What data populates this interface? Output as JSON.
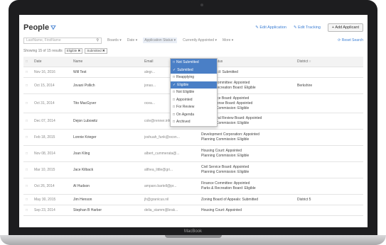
{
  "device": {
    "brand": "MacBook"
  },
  "header": {
    "title": "People",
    "title_icon": "funnel-icon",
    "edit_application": "Edit Application",
    "edit_tracking": "Edit Tracking",
    "add_applicant": "+ Add Applicant"
  },
  "filters": {
    "search_placeholder": "LastName, FirstName",
    "boards": "Boards",
    "date": "Date",
    "application_status": "Application Status",
    "currently_appointed": "Currently Appointed",
    "more": "More",
    "reset": "Reset Search"
  },
  "results": {
    "text": "Showing 15 of 15 results",
    "chips": [
      "Eligible",
      "Submitted"
    ]
  },
  "status_menu": {
    "items": [
      {
        "label": "Not Submitted",
        "checked": false,
        "highlighted": true
      },
      {
        "label": "Submitted",
        "checked": true,
        "highlighted": true
      },
      {
        "label": "Reapplying",
        "checked": false,
        "highlighted": false
      },
      {
        "label": "Eligible",
        "checked": true,
        "highlighted": true
      },
      {
        "label": "Not Eligible",
        "checked": false,
        "highlighted": false
      },
      {
        "label": "Appointed",
        "checked": false,
        "highlighted": false
      },
      {
        "label": "For Review",
        "checked": false,
        "highlighted": false
      },
      {
        "label": "On Agenda",
        "checked": false,
        "highlighted": false
      },
      {
        "label": "Archived",
        "checked": false,
        "highlighted": false
      }
    ]
  },
  "table": {
    "headers": [
      "Date",
      "Name",
      "Email",
      "Board: Status",
      "District"
    ],
    "rows": [
      {
        "date": "Nov 16, 2016",
        "name": "Will Test",
        "email": "alegr...",
        "status": "City Council: Submitted",
        "district": ""
      },
      {
        "date": "Oct 15, 2014",
        "name": "Jovani Pollich",
        "email": "jonas...",
        "status": "Finance Committee: Appointed\nParks & Recreation Board: Eligible",
        "district": "Berkshire"
      },
      {
        "date": "Oct 31, 2014",
        "name": "Tito MacGyver",
        "email": "ocea...",
        "status": "Civil Service Board: Appointed\nLiquor License Board: Appointed\nPlanning Commission: Eligible",
        "district": ""
      },
      {
        "date": "Dec 07, 2014",
        "name": "Dejon Lubowitz",
        "email": "cole@renner.info",
        "status": "Architectural Review Board: Appointed\nPlanning Commission: Eligible",
        "district": ""
      },
      {
        "date": "Feb 18, 2015",
        "name": "Lonnie Krieger",
        "email": "joshuah_funk@ocon...",
        "status": "Development Corporation: Appointed\nPlanning Commission: Eligible",
        "district": ""
      },
      {
        "date": "Nov 08, 2014",
        "name": "Joan Kling",
        "email": "albert_cummerata@...",
        "status": "Housing Court: Appointed\nPlanning Commission: Eligible",
        "district": ""
      },
      {
        "date": "Mar 10, 2015",
        "name": "Jace Kilback",
        "email": "althea_little@gri...",
        "status": "Civil Service Board: Appointed\nPlanning Commission: Eligible",
        "district": ""
      },
      {
        "date": "Oct 26, 2014",
        "name": "Al Hudson",
        "email": "amparo.bartell@pr...",
        "status": "Finance Committee: Appointed\nParks & Recreation Board: Eligible",
        "district": ""
      },
      {
        "date": "May 30, 2015",
        "name": "Jim Henson",
        "email": "jh@granicus.nil",
        "status": "Zoning Board of Appeals: Submitted",
        "district": "District 5"
      },
      {
        "date": "Sep 23, 2014",
        "name": "Stephan B Harber",
        "email": "delia_stamm@brak...",
        "status": "Housing Court: Appointed",
        "district": ""
      }
    ]
  },
  "colors": {
    "accent": "#3d7fd4",
    "menu_highlight": "#4a7fc6"
  }
}
